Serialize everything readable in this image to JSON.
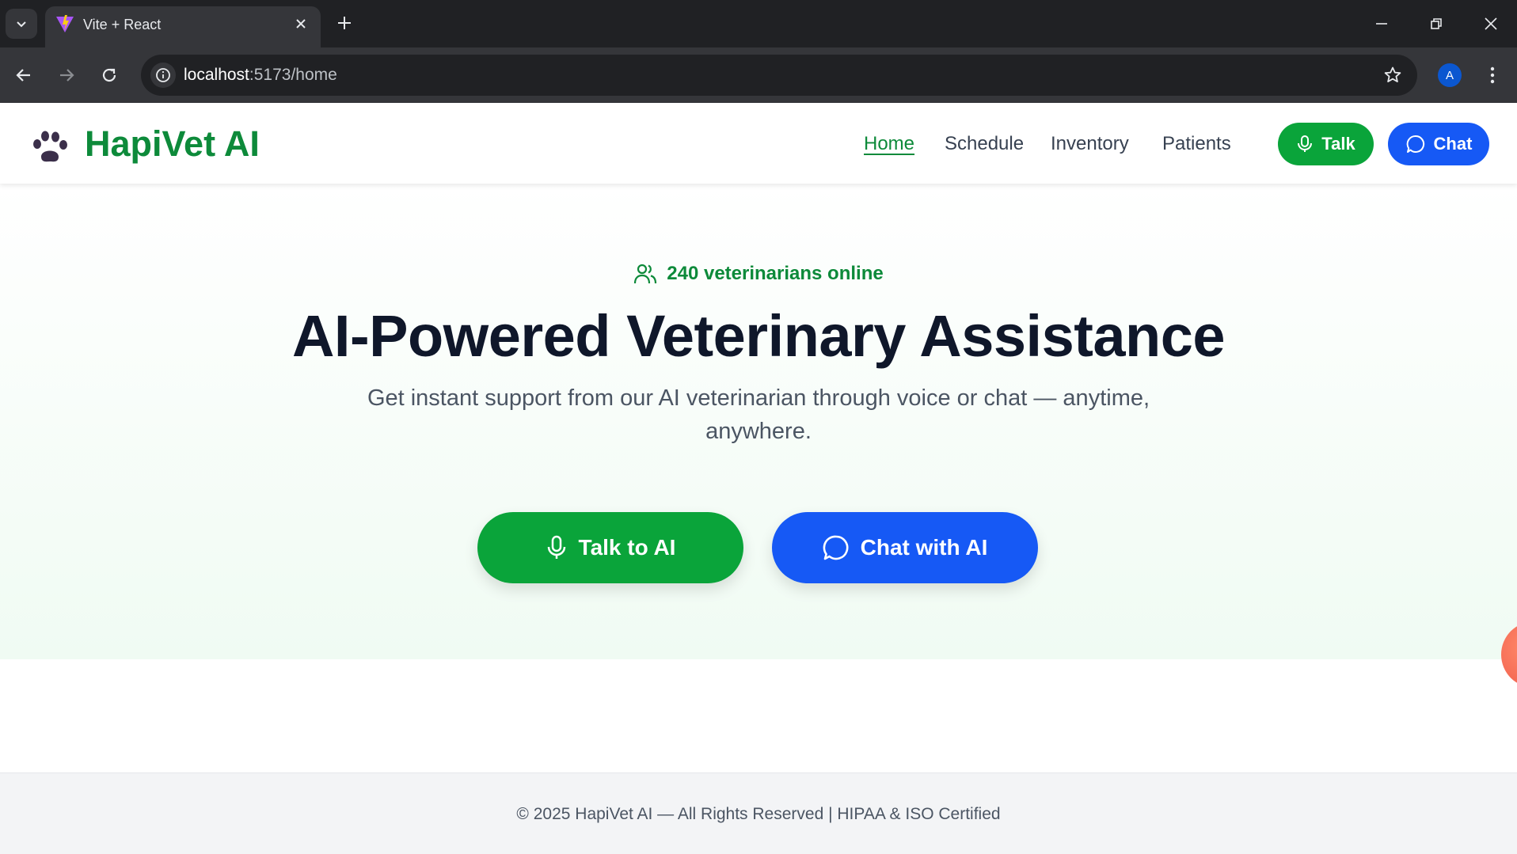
{
  "browser": {
    "tab_title": "Vite + React",
    "url_host": "localhost",
    "url_path": ":5173/home",
    "profile_initial": "A"
  },
  "header": {
    "brand": "HapiVet AI",
    "logo_icon": "paw-icon",
    "nav": [
      "Home",
      "Schedule",
      "Inventory",
      "Patients"
    ],
    "active_nav": "Home",
    "talk_label": "Talk",
    "chat_label": "Chat"
  },
  "hero": {
    "online_text": "240 veterinarians online",
    "headline": "AI-Powered Veterinary Assistance",
    "subtext": "Get instant support from our AI veterinarian through voice or chat — anytime, anywhere.",
    "talk_cta": "Talk to AI",
    "chat_cta": "Chat with AI"
  },
  "footer": {
    "text": "© 2025 HapiVet AI — All Rights Reserved | HIPAA & ISO Certified"
  },
  "colors": {
    "brand_green": "#0d8a3a",
    "button_green": "#0aa43a",
    "button_blue": "#1659f5",
    "headline": "#0f172a"
  }
}
